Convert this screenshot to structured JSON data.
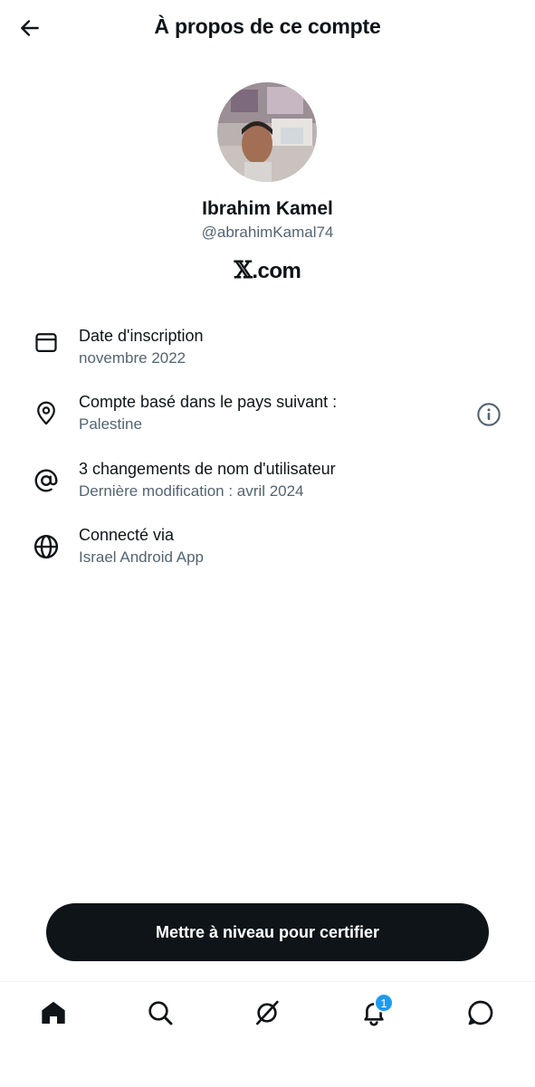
{
  "header": {
    "title": "À propos de ce compte"
  },
  "profile": {
    "name": "Ibrahim Kamel",
    "handle": "@abrahimKamal74",
    "site": ".com"
  },
  "details": [
    {
      "icon": "calendar-icon",
      "label": "Date d'inscription",
      "value": "novembre 2022"
    },
    {
      "icon": "location-pin-icon",
      "label": "Compte basé dans le pays suivant :",
      "value": "Palestine"
    },
    {
      "icon": "at-sign-icon",
      "label": "3 changements de nom d'utilisateur",
      "value": "Dernière modification : avril 2024"
    },
    {
      "icon": "globe-icon",
      "label": "Connecté via",
      "value": "Israel Android App"
    }
  ],
  "cta": {
    "label": "Mettre à niveau pour certifier"
  },
  "tabbar": {
    "tabs": [
      "home-icon",
      "search-icon",
      "grok-icon",
      "bell-icon",
      "messages-icon"
    ],
    "notifications_badge": "1"
  },
  "colors": {
    "primary_text": "#0f1419",
    "secondary_text": "#536471",
    "accent": "#1d9bf0",
    "button_bg": "#0f1419"
  }
}
